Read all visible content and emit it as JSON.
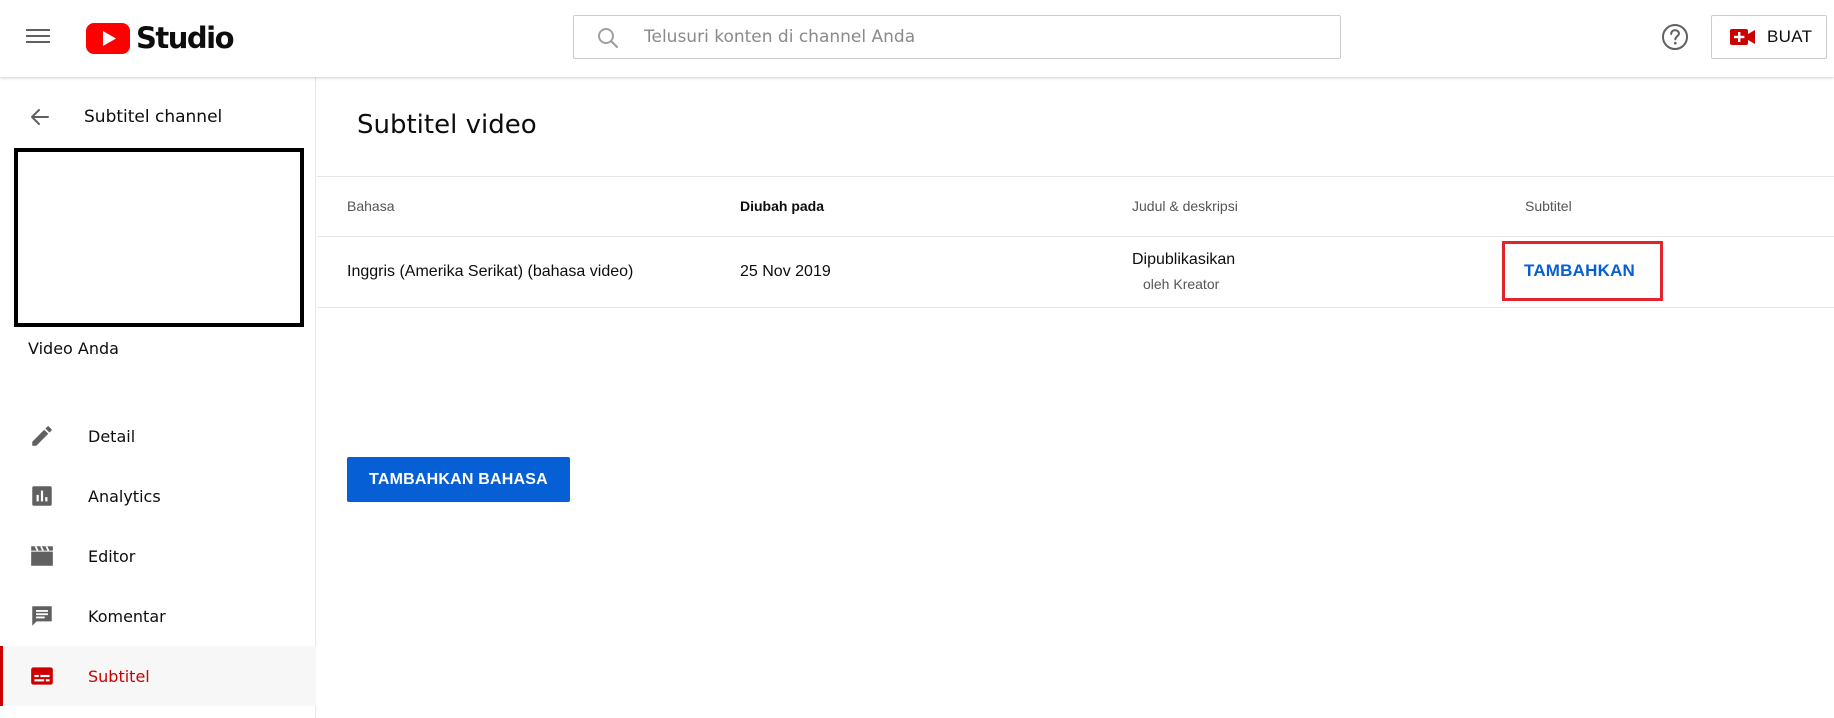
{
  "header": {
    "logo_text": "Studio",
    "search_placeholder": "Telusuri konten di channel Anda",
    "create_label": "BUAT",
    "icons": [
      "menu-icon",
      "youtube-play-icon",
      "search-icon",
      "help-icon",
      "video-camera-plus-icon"
    ]
  },
  "sidebar": {
    "back_label": "Subtitel channel",
    "video_title": "Video Anda",
    "items": [
      {
        "label": "Detail",
        "icon": "pencil-icon",
        "active": false
      },
      {
        "label": "Analytics",
        "icon": "analytics-icon",
        "active": false
      },
      {
        "label": "Editor",
        "icon": "clapperboard-icon",
        "active": false
      },
      {
        "label": "Komentar",
        "icon": "comment-icon",
        "active": false
      },
      {
        "label": "Subtitel",
        "icon": "subtitles-icon",
        "active": true
      }
    ]
  },
  "main": {
    "title": "Subtitel video",
    "columns": [
      "Bahasa",
      "Diubah pada",
      "Judul & deskripsi",
      "Subtitel"
    ],
    "rows": [
      {
        "language": "Inggris (Amerika Serikat) (bahasa video)",
        "modified": "25 Nov 2019",
        "title_status": "Dipublikasikan",
        "title_by": "oleh Kreator",
        "subtitle_action": "TAMBAHKAN"
      }
    ],
    "add_language_label": "TAMBAHKAN BAHASA"
  },
  "colors": {
    "brand_red": "#ff0000",
    "accent_blue": "#065fd4",
    "active_red": "#cc0000",
    "highlight_box": "#e0262c"
  }
}
